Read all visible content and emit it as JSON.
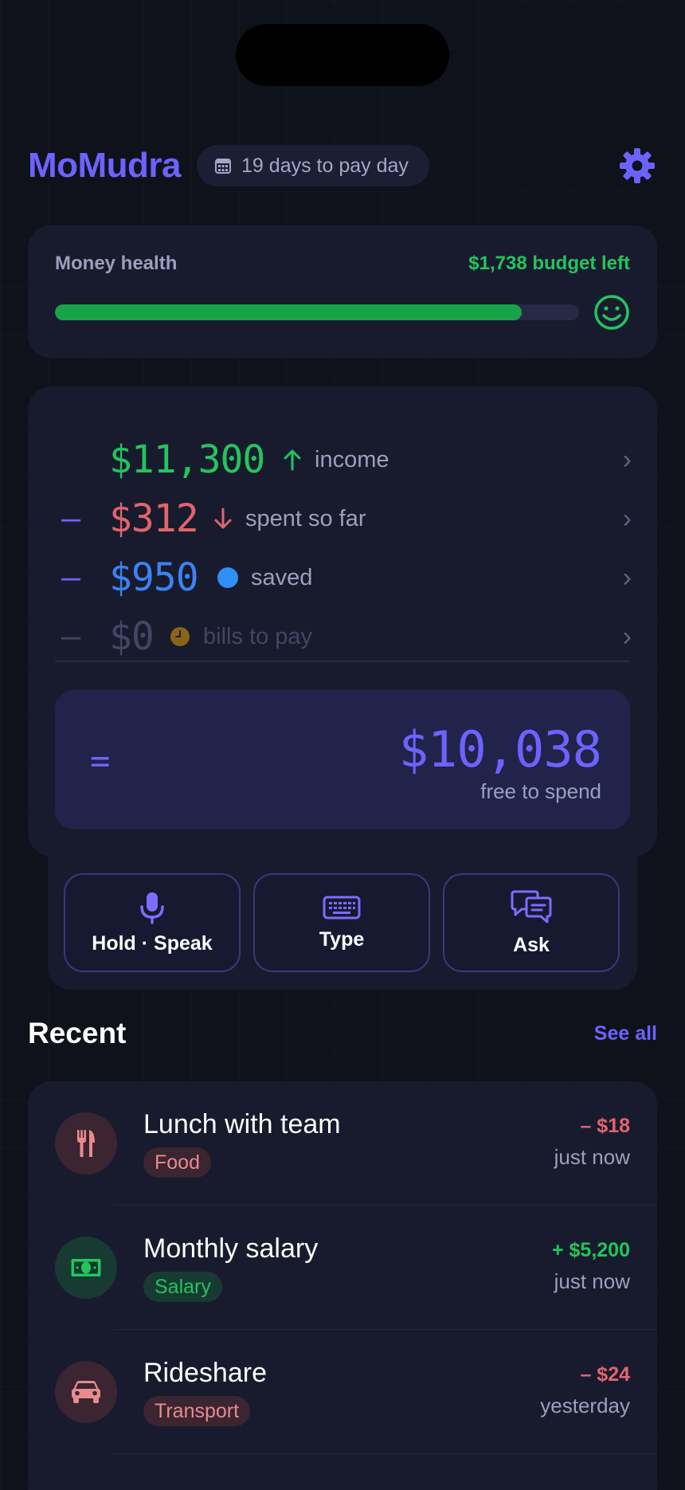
{
  "app": {
    "brand": "MoMudra"
  },
  "header": {
    "payday_text": "19 days to pay day",
    "calendar_icon": "calendar-icon",
    "settings_icon": "gear-icon"
  },
  "health": {
    "label": "Money health",
    "budget_left": "$1,738 budget left",
    "progress": 0.89,
    "mood_icon": "smiley-icon"
  },
  "summary": {
    "rows": [
      {
        "sign": "",
        "amount": "$11,300",
        "label": "income",
        "indicator": "arrow-up-icon",
        "color": "#22c55e"
      },
      {
        "sign": "–",
        "amount": "$312",
        "label": "spent so far",
        "indicator": "arrow-down-icon",
        "color": "#e0646e"
      },
      {
        "sign": "–",
        "amount": "$950",
        "label": "saved",
        "indicator": "blue-dot-icon",
        "color": "#3b82f6"
      },
      {
        "sign": "–",
        "amount": "$0",
        "label": "bills to pay",
        "indicator": "clock-icon",
        "color": "#414663"
      }
    ],
    "equals": "=",
    "free_amount": "$10,038",
    "free_label": "free to spend"
  },
  "actions": [
    {
      "label": "Hold · Speak",
      "icon": "microphone-icon"
    },
    {
      "label": "Type",
      "icon": "keyboard-icon"
    },
    {
      "label": "Ask",
      "icon": "chat-bubbles-icon"
    }
  ],
  "recent": {
    "title": "Recent",
    "see_all": "See all",
    "items": [
      {
        "title": "Lunch with team",
        "tag": "Food",
        "amount": "– $18",
        "when": "just now",
        "icon": "fork-knife-icon",
        "kind": "expense"
      },
      {
        "title": "Monthly salary",
        "tag": "Salary",
        "amount": "+ $5,200",
        "when": "just now",
        "icon": "cash-icon",
        "kind": "income"
      },
      {
        "title": "Rideshare",
        "tag": "Transport",
        "amount": "– $24",
        "when": "yesterday",
        "icon": "car-icon",
        "kind": "expense"
      }
    ]
  },
  "colors": {
    "accent": "#6c63ff",
    "income": "#22c55e",
    "expense": "#e0646e",
    "saved": "#3b82f6",
    "bills": "#b7811c"
  }
}
